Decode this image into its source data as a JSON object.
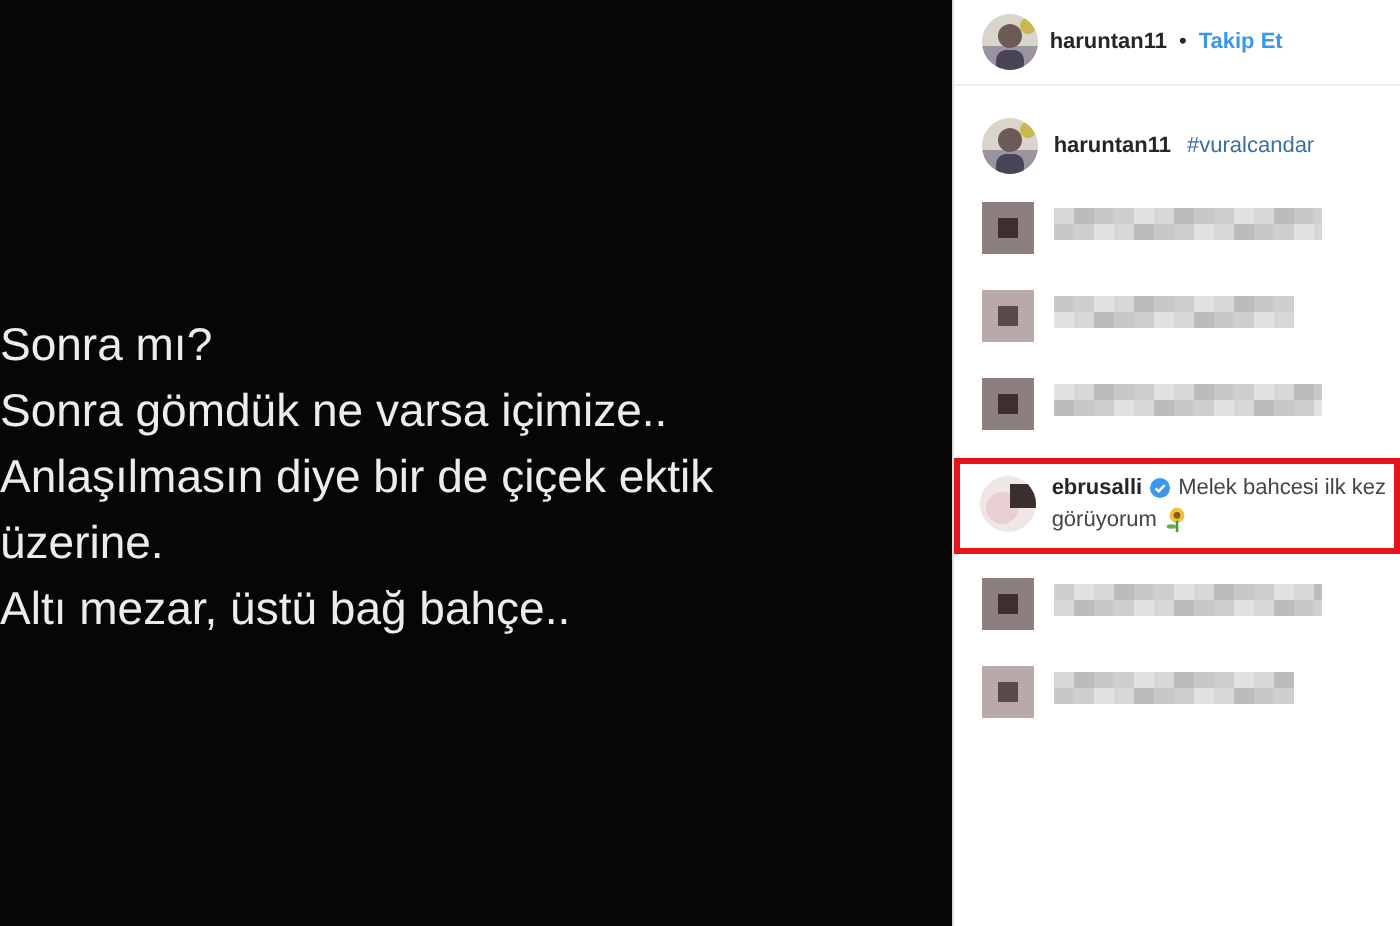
{
  "post": {
    "lines": [
      "Sonra mı?",
      "Sonra gömdük ne varsa içimize..",
      "Anlaşılmasın diye bir de çiçek ektik",
      "üzerine.",
      "Altı mezar, üstü bağ bahçe.."
    ]
  },
  "header": {
    "username": "haruntan11",
    "separator": "•",
    "follow": "Takip Et"
  },
  "caption": {
    "username": "haruntan11",
    "hashtag": "#vuralcandar"
  },
  "comments": [
    {
      "kind": "blurred"
    },
    {
      "kind": "blurred"
    },
    {
      "kind": "blurred"
    },
    {
      "kind": "text",
      "highlighted": true,
      "username": "ebrusalli",
      "verified": true,
      "text": "Melek bahcesi ilk kez",
      "continuation": "görüyorum"
    },
    {
      "kind": "blurred"
    },
    {
      "kind": "blurred"
    }
  ]
}
